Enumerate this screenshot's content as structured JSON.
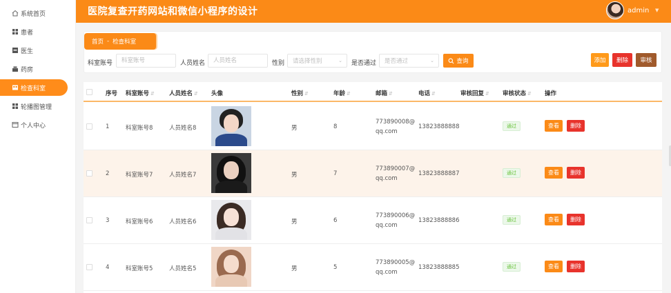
{
  "header": {
    "title": "医院复查开药网站和微信小程序的设计",
    "user": "admin",
    "caret": "▼"
  },
  "sidebar": {
    "items": [
      {
        "label": "系统首页",
        "icon": "home-icon",
        "active": false
      },
      {
        "label": "患者",
        "icon": "grid-icon",
        "active": false
      },
      {
        "label": "医生",
        "icon": "doctor-icon",
        "active": false
      },
      {
        "label": "药房",
        "icon": "pharmacy-icon",
        "active": false
      },
      {
        "label": "检查科室",
        "icon": "department-icon",
        "active": true
      },
      {
        "label": "轮播图管理",
        "icon": "grid-icon",
        "active": false
      },
      {
        "label": "个人中心",
        "icon": "profile-icon",
        "active": false
      }
    ]
  },
  "breadcrumb": {
    "home": "首页",
    "sep": "-",
    "current": "检查科室"
  },
  "filters": {
    "account_label": "科室账号",
    "account_placeholder": "科室账号",
    "name_label": "人员姓名",
    "name_placeholder": "人员姓名",
    "gender_label": "性别",
    "gender_placeholder": "请选择性别",
    "passed_label": "是否通过",
    "passed_placeholder": "是否通过",
    "search_label": "查询"
  },
  "actions": {
    "add": "添加",
    "delete": "删除",
    "audit": "审核"
  },
  "table": {
    "headers": [
      "序号",
      "科室账号",
      "人员姓名",
      "头像",
      "性别",
      "年龄",
      "邮箱",
      "电话",
      "审核回复",
      "审核状态",
      "操作"
    ],
    "rows": [
      {
        "index": "1",
        "account": "科室账号8",
        "name": "人员姓名8",
        "gender": "男",
        "age": "8",
        "email": "773890008@qq.com",
        "phone": "13823888888",
        "reply": "",
        "status": "通过",
        "view": "查看",
        "delete": "删除",
        "photo_icon": "avatar-photo-icon"
      },
      {
        "index": "2",
        "account": "科室账号7",
        "name": "人员姓名7",
        "gender": "男",
        "age": "7",
        "email": "773890007@qq.com",
        "phone": "13823888887",
        "reply": "",
        "status": "通过",
        "view": "查看",
        "delete": "删除",
        "photo_icon": "avatar-photo-icon"
      },
      {
        "index": "3",
        "account": "科室账号6",
        "name": "人员姓名6",
        "gender": "男",
        "age": "6",
        "email": "773890006@qq.com",
        "phone": "13823888886",
        "reply": "",
        "status": "通过",
        "view": "查看",
        "delete": "删除",
        "photo_icon": "avatar-photo-icon"
      },
      {
        "index": "4",
        "account": "科室账号5",
        "name": "人员姓名5",
        "gender": "男",
        "age": "5",
        "email": "773890005@qq.com",
        "phone": "13823888885",
        "reply": "",
        "status": "通过",
        "view": "查看",
        "delete": "删除",
        "photo_icon": "avatar-photo-icon"
      }
    ]
  },
  "colors": {
    "accent": "#fb8a17",
    "danger": "#e8332c",
    "audit": "#a05a2c",
    "success": "#67c23a"
  }
}
